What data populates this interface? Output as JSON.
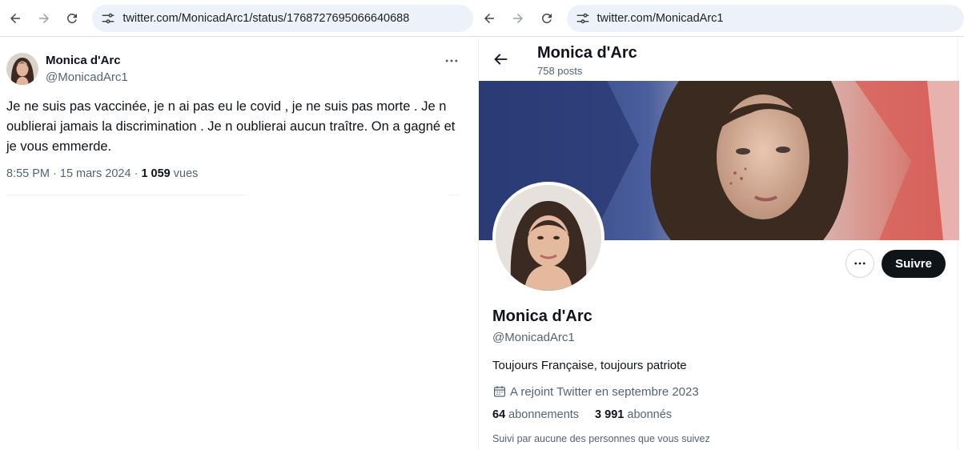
{
  "left_browser": {
    "url": "twitter.com/MonicadArc1/status/1768727695066640688"
  },
  "right_browser": {
    "url": "twitter.com/MonicadArc1"
  },
  "tweet": {
    "author_name": "Monica d'Arc",
    "author_handle": "@MonicadArc1",
    "text": "Je ne suis pas vaccinée,  je n ai pas eu le covid , je ne suis pas morte . Je n oublierai jamais la discrimination . Je n oublierai aucun traître. On a gagné et je vous emmerde.",
    "time_date": "8:55 PM · 15 mars 2024 · ",
    "views_count": "1 059",
    "views_label": " vues"
  },
  "profile": {
    "header_title": "Monica d'Arc",
    "posts_count": "758 posts",
    "name": "Monica d'Arc",
    "handle": "@MonicadArc1",
    "bio": "Toujours Française, toujours patriote",
    "joined": "A rejoint Twitter en septembre 2023",
    "following_count": "64",
    "following_label": "abonnements",
    "followers_count": "3 991",
    "followers_label": "abonnés",
    "followed_by": "Suivi par aucune des personnes que vous suivez",
    "follow_button": "Suivre"
  },
  "icons": [
    "back-arrow-icon",
    "forward-arrow-icon",
    "reload-icon",
    "site-settings-icon",
    "more-icon",
    "calendar-icon"
  ],
  "colors": {
    "text_primary": "#0f1419",
    "text_secondary": "#536471",
    "url_bar": "#edf1fa",
    "follow_button_bg": "#0f1419"
  }
}
